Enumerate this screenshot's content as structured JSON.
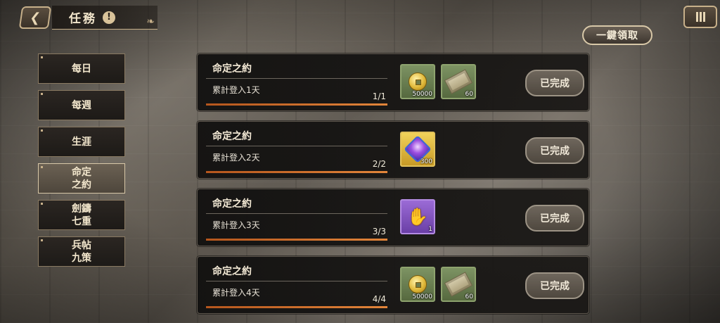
{
  "header": {
    "title": "任務",
    "info_icon": "info-icon"
  },
  "claim_all_label": "一鍵領取",
  "sidebar": {
    "items": [
      {
        "label": "每日",
        "active": false
      },
      {
        "label": "每週",
        "active": false
      },
      {
        "label": "生涯",
        "active": false
      },
      {
        "label": "命定\n之約",
        "active": true
      },
      {
        "label": "劍鑄\n七重",
        "active": false
      },
      {
        "label": "兵帖\n九策",
        "active": false
      }
    ]
  },
  "tasks": [
    {
      "title": "命定之約",
      "desc": "累計登入1天",
      "progress": "1/1",
      "progress_fraction": 1.0,
      "button": "已完成",
      "rewards": [
        {
          "icon": "gold-coin-icon",
          "count": "50000"
        },
        {
          "icon": "scroll-icon",
          "count": "60"
        }
      ]
    },
    {
      "title": "命定之約",
      "desc": "累計登入2天",
      "progress": "2/2",
      "progress_fraction": 1.0,
      "button": "已完成",
      "rewards": [
        {
          "icon": "gem-icon",
          "count": "300"
        }
      ]
    },
    {
      "title": "命定之約",
      "desc": "累計登入3天",
      "progress": "3/3",
      "progress_fraction": 1.0,
      "button": "已完成",
      "rewards": [
        {
          "icon": "glove-icon",
          "count": "1"
        }
      ]
    },
    {
      "title": "命定之約",
      "desc": "累計登入4天",
      "progress": "4/4",
      "progress_fraction": 1.0,
      "button": "已完成",
      "rewards": [
        {
          "icon": "gold-coin-icon",
          "count": "50000"
        },
        {
          "icon": "scroll-icon",
          "count": "60"
        }
      ]
    }
  ],
  "colors": {
    "accent_gold": "#c7b08a",
    "progress_orange": "#e2853a",
    "card_bg": "#121110"
  }
}
